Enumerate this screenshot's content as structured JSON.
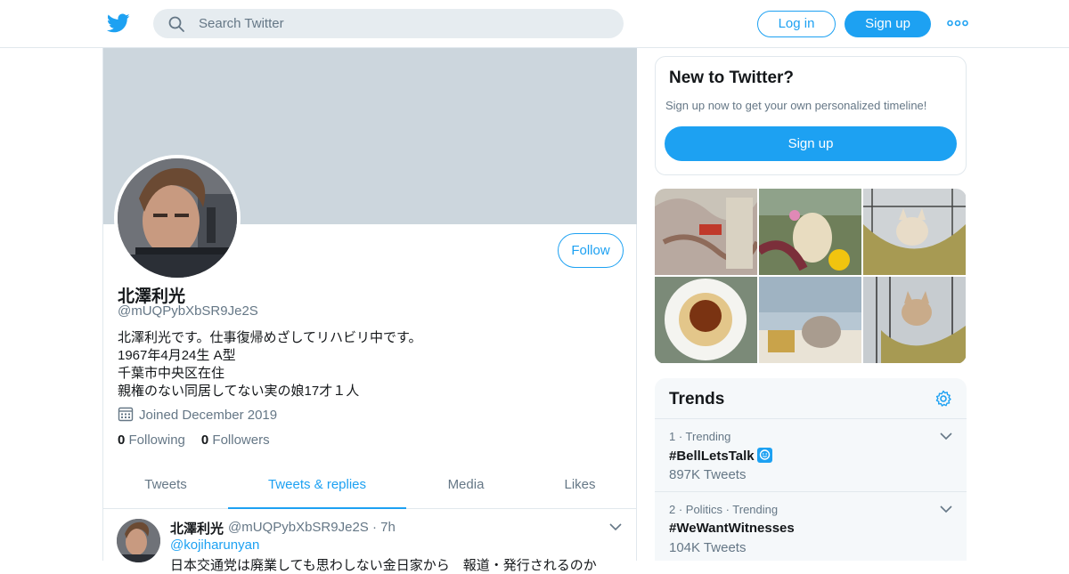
{
  "header": {
    "search_placeholder": "Search Twitter",
    "login_label": "Log in",
    "signup_label": "Sign up"
  },
  "profile": {
    "follow_label": "Follow",
    "name": "北澤利光",
    "handle": "@mUQPybXbSR9Je2S",
    "bio": [
      "北澤利光です。仕事復帰めざしてリハビリ中です。",
      "1967年4月24生 A型",
      "千葉市中央区在住",
      "親権のない同居してない実の娘17才１人"
    ],
    "joined": "Joined December 2019",
    "following_count": "0",
    "following_label": "Following",
    "followers_count": "0",
    "followers_label": "Followers"
  },
  "tabs": [
    {
      "label": "Tweets",
      "active": false
    },
    {
      "label": "Tweets & replies",
      "active": true
    },
    {
      "label": "Media",
      "active": false
    },
    {
      "label": "Likes",
      "active": false
    }
  ],
  "tweet": {
    "name": "北澤利光",
    "meta": "@mUQPybXbSR9Je2S · 7h",
    "reply_to": "@kojiharunyan",
    "body": "日本交通党は廃業しても思わしない金日家から　報道・発行されるのか"
  },
  "signup_card": {
    "title": "New to Twitter?",
    "subtitle": "Sign up now to get your own personalized timeline!",
    "button_label": "Sign up"
  },
  "trends": {
    "title": "Trends",
    "items": [
      {
        "meta": "1 · Trending",
        "tag": "#BellLetsTalk",
        "count": "897K Tweets",
        "emoji": true
      },
      {
        "meta": "2 · Politics · Trending",
        "tag": "#WeWantWitnesses",
        "count": "104K Tweets",
        "emoji": false
      }
    ]
  },
  "colors": {
    "accent": "#1da1f2",
    "banner": "#ccd6dd",
    "muted_text": "#657786",
    "border": "#e1e8ed"
  }
}
